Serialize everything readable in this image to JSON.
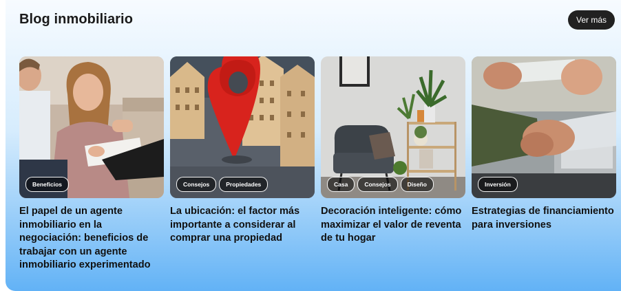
{
  "header": {
    "title": "Blog inmobiliario",
    "more_label": "Ver más"
  },
  "cards": [
    {
      "title": "El papel de un agente inmobiliario en la negociación: beneficios de trabajar con un agente inmobiliario experimentado",
      "tags": [
        "Beneficios"
      ],
      "image": "couple-signing-contract-photo"
    },
    {
      "title": "La ubicación: el factor más importante a considerar al comprar una propiedad",
      "tags": [
        "Consejos",
        "Propiedades"
      ],
      "image": "red-location-pin-photo"
    },
    {
      "title": "Decoración inteligente: cómo maximizar el valor de reventa de tu hogar",
      "tags": [
        "Casa",
        "Consejos",
        "Diseño"
      ],
      "image": "living-room-armchair-photo"
    },
    {
      "title": "Estrategias de financiamiento para inversiones",
      "tags": [
        "Inversión"
      ],
      "image": "handshake-photo"
    }
  ]
}
